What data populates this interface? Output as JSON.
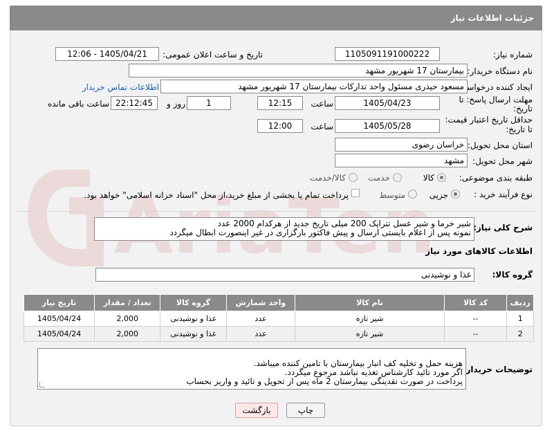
{
  "header": {
    "title": "جزئیات اطلاعات نیاز"
  },
  "need_number": {
    "label": "شماره نیاز:",
    "value": "1105091191000222"
  },
  "announce": {
    "label": "تاریخ و ساعت اعلان عمومی:",
    "value": "1405/04/21 - 12:06"
  },
  "buyer_org": {
    "label": "نام دستگاه خریدار:",
    "value": "بیمارستان 17 شهریور مشهد"
  },
  "requester": {
    "label": "ایجاد کننده درخواست:",
    "value": "مسعود حیدری مسئول واحد تدارکات  بیمارستان 17 شهریور مشهد",
    "contact_link": "اطلاعات تماس خریدار"
  },
  "reply_deadline": {
    "label_line1": "مهلت ارسال پاسخ: تا",
    "label_line2": "تاریخ:",
    "date": "1405/04/23",
    "time_label": "ساعت",
    "time": "12:15",
    "days": "1",
    "days_label": "روز و",
    "remaining": "22:12:45",
    "remaining_label": "ساعت باقی مانده"
  },
  "price_validity": {
    "label_line1": "حداقل تاریخ اعتبار قیمت:",
    "label_line2": "تا تاریخ:",
    "date": "1405/05/28",
    "time_label": "ساعت",
    "time": "12:00"
  },
  "delivery_province": {
    "label": "استان محل تحویل:",
    "value": "خراسان رضوی"
  },
  "delivery_city": {
    "label": "شهر محل تحویل:",
    "value": "مشهد"
  },
  "category": {
    "label": "طبقه بندی موضوعی:",
    "options": [
      "کالا",
      "خدمت",
      "کالا/خدمت"
    ],
    "selected": "کالا"
  },
  "purchase_type": {
    "label": "نوع فرآیند خرید :",
    "options": [
      "جزیی",
      "متوسط"
    ],
    "selected": "جزیی",
    "payment_note": "پرداخت تمام یا بخشی از مبلغ خرید،از محل \"اسناد خزانه اسلامی\" خواهد بود."
  },
  "description": {
    "label": "شرح کلی نیاز:",
    "text": "شیر خرما و شیر عسل تتراپک 200 میلی تاریخ جدید از هرکدام 2000 عدد\nنمونه پس از اعلام بایستی ارسال و پیش فاکتور بارگزاری در غیر اینصورت ابطال میگردد"
  },
  "goods_info": {
    "title": "اطلاعات کالاهای مورد نیاز"
  },
  "goods_group": {
    "label": "گروه کالا:",
    "value": "غذا و نوشیدنی"
  },
  "table": {
    "headers": [
      "ردیف",
      "کد کالا",
      "نام کالا",
      "واحد شمارش",
      "گروه کالا",
      "تعداد / مقدار",
      "تاریخ نیاز"
    ],
    "rows": [
      [
        "1",
        "--",
        "شیر تازه",
        "عدد",
        "غذا و نوشیدنی",
        "2,000",
        "1405/04/24"
      ],
      [
        "2",
        "--",
        "شیر تازه",
        "عدد",
        "غذا و نوشیدنی",
        "2,000",
        "1405/04/24"
      ]
    ]
  },
  "buyer_notes": {
    "label": "توضیحات خریدار:",
    "text": "هزینه حمل و تخلیه کف انبار بیمارستان با تامین کننده میباشد.\nاگر مورد تائید کارشناس تغذیه نباشد مرجوع میگردد.\nپرداخت در صورت نقدینگی بیمارستان 2 ماه پس از تحویل و تائید و واریز بحساب"
  },
  "buttons": {
    "back": "بازگشت",
    "print": "چاپ"
  },
  "colors": {
    "header_bg": "#8a8a8a",
    "link": "#1a5fb4",
    "panel_bg": "#f2f2f2"
  },
  "watermark": "AriaTender.net"
}
